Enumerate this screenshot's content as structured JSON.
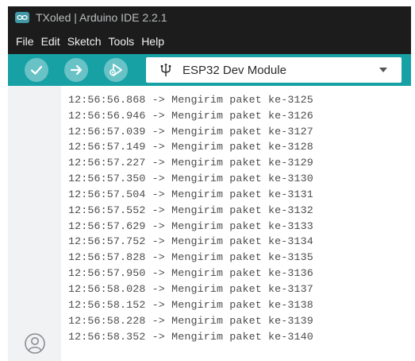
{
  "window": {
    "title": "TXoled | Arduino IDE 2.2.1"
  },
  "menu": [
    "File",
    "Edit",
    "Sketch",
    "Tools",
    "Help"
  ],
  "toolbar": {
    "board": "ESP32 Dev Module",
    "icons": [
      "verify-check-icon",
      "upload-arrow-icon",
      "debugger-icon",
      "usb-icon",
      "chevron-down-icon"
    ]
  },
  "sidebar": {
    "icons": [
      "profile-icon"
    ]
  },
  "serial_log": [
    "12:56:56.868 -> Mengirim paket ke-3125",
    "12:56:56.946 -> Mengirim paket ke-3126",
    "12:56:57.039 -> Mengirim paket ke-3127",
    "12:56:57.149 -> Mengirim paket ke-3128",
    "12:56:57.227 -> Mengirim paket ke-3129",
    "12:56:57.350 -> Mengirim paket ke-3130",
    "12:56:57.504 -> Mengirim paket ke-3131",
    "12:56:57.552 -> Mengirim paket ke-3132",
    "12:56:57.629 -> Mengirim paket ke-3133",
    "12:56:57.752 -> Mengirim paket ke-3134",
    "12:56:57.828 -> Mengirim paket ke-3135",
    "12:56:57.950 -> Mengirim paket ke-3136",
    "12:56:58.028 -> Mengirim paket ke-3137",
    "12:56:58.152 -> Mengirim paket ke-3138",
    "12:56:58.228 -> Mengirim paket ke-3139",
    "12:56:58.352 -> Mengirim paket ke-3140"
  ],
  "colors": {
    "titlebar": "#1c1c1c",
    "toolbar": "#17a1a5",
    "toolbar_button": "#69c3c6",
    "sidebar": "#f0f2f3",
    "log_text": "#4c4c4c"
  }
}
